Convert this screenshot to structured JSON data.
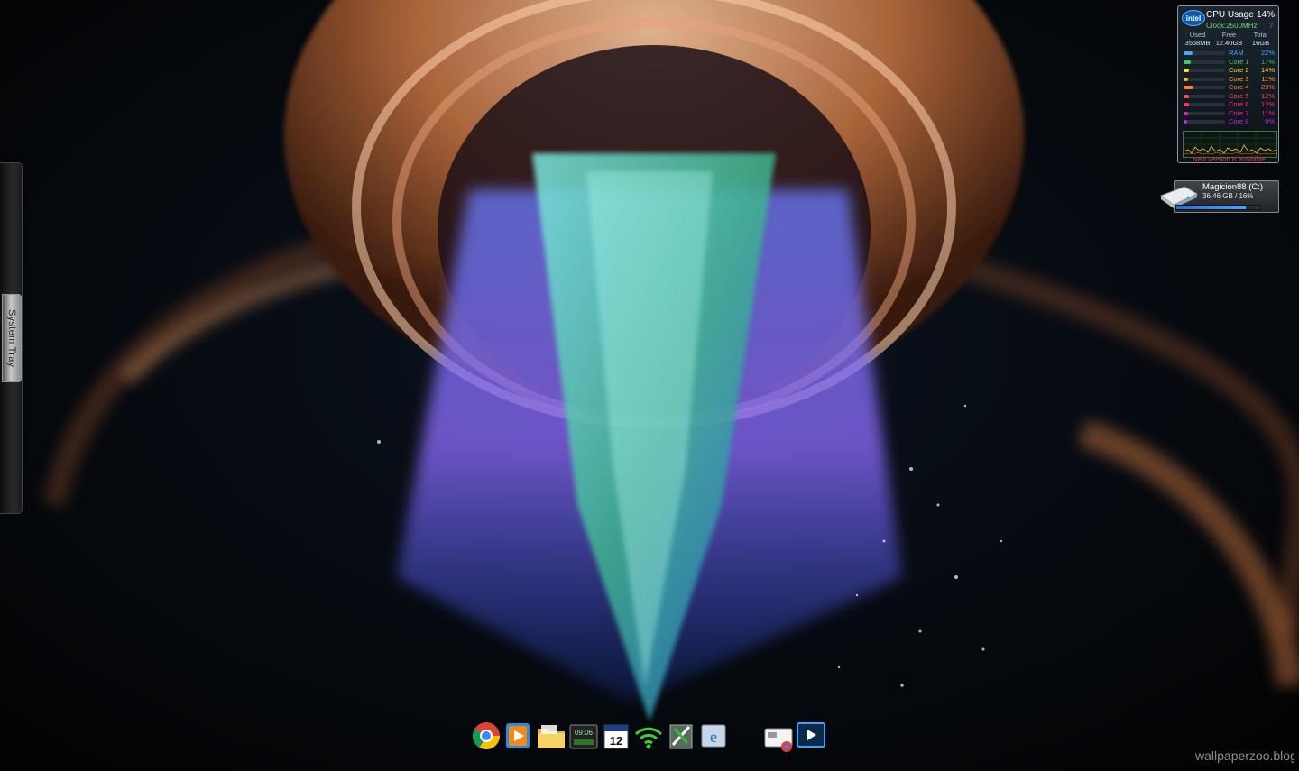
{
  "system_tray": {
    "label": "System Tray"
  },
  "cpu_gadget": {
    "brand": "intel",
    "title": "CPU Usage",
    "usage": "14%",
    "clock": "Clock:2500MHz",
    "clock_flag": "?",
    "memory_headers": [
      "Used",
      "Free",
      "Total"
    ],
    "memory_values": [
      "3568MB",
      "12.40GB",
      "16GB"
    ],
    "bars": [
      {
        "name": "RAM",
        "value": "22%",
        "percent": 22,
        "color": "#49a6ff"
      },
      {
        "name": "Core 1",
        "value": "17%",
        "percent": 17,
        "color": "#35d06a"
      },
      {
        "name": "Core 2",
        "value": "14%",
        "percent": 14,
        "color": "#ffd83a"
      },
      {
        "name": "Core 3",
        "value": "11%",
        "percent": 11,
        "color": "#ffb02a"
      },
      {
        "name": "Core 4",
        "value": "23%",
        "percent": 23,
        "color": "#ff7f2a"
      },
      {
        "name": "Core 5",
        "value": "12%",
        "percent": 12,
        "color": "#ff4d4d"
      },
      {
        "name": "Core 6",
        "value": "12%",
        "percent": 12,
        "color": "#ff2f6e"
      },
      {
        "name": "Core 7",
        "value": "11%",
        "percent": 11,
        "color": "#e02aa8"
      },
      {
        "name": "Core 8",
        "value": "9%",
        "percent": 9,
        "color": "#c02ad0"
      }
    ],
    "note": "New version is available"
  },
  "drive_gadget": {
    "name": "Magicion88 (C:)",
    "stats": "36.46 GB / 16%",
    "used_percent": 84
  },
  "dock": {
    "icons": [
      "chrome-icon",
      "media-player-icon",
      "folder-icon",
      "clock-gadget-icon",
      "calendar-icon",
      "wifi-icon",
      "tools-icon",
      "ie-icon",
      "network-icon",
      "remote-desktop-icon"
    ],
    "clock_time": "09:06",
    "calendar_day": "12"
  },
  "watermark": {
    "text": "wallpaperzoo.blogspot.com"
  }
}
